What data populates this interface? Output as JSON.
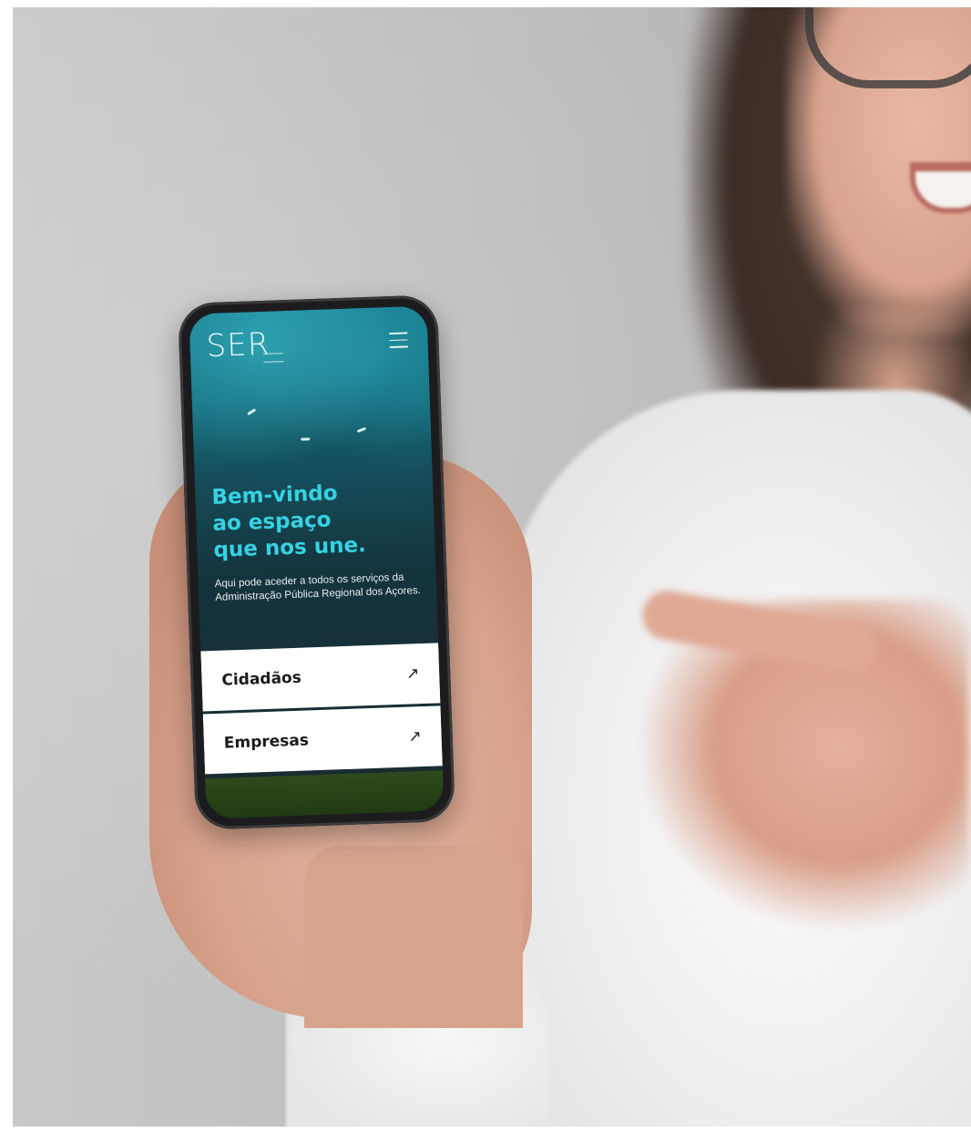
{
  "phone_screen": {
    "logo_text": "SER",
    "hero": {
      "title": "Bem-vindo\nao espaço\nque nos une.",
      "text": "Aqui pode aceder a todos os serviços da Administração Pública Regional dos Açores."
    },
    "cards": [
      {
        "label": "Cidadãos",
        "arrow": "↗"
      },
      {
        "label": "Empresas",
        "arrow": "↗"
      }
    ]
  },
  "colors": {
    "accent": "#35d2e2",
    "screen_bg": "#14343d",
    "card_bg": "#ffffff"
  },
  "icons": [
    "menu-icon",
    "arrow-up-right-icon"
  ]
}
